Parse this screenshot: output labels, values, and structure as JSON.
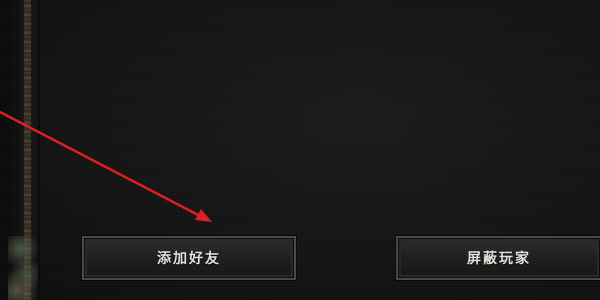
{
  "buttons": {
    "add_friend": "添加好友",
    "block_player": "屏蔽玩家"
  },
  "colors": {
    "background": "#151515",
    "button_border": "#4b4a46",
    "button_text": "#e8e4dc",
    "annotation_arrow": "#e02020"
  },
  "annotation": {
    "icon": "red-arrow-pointing-to-add-friend-button"
  }
}
